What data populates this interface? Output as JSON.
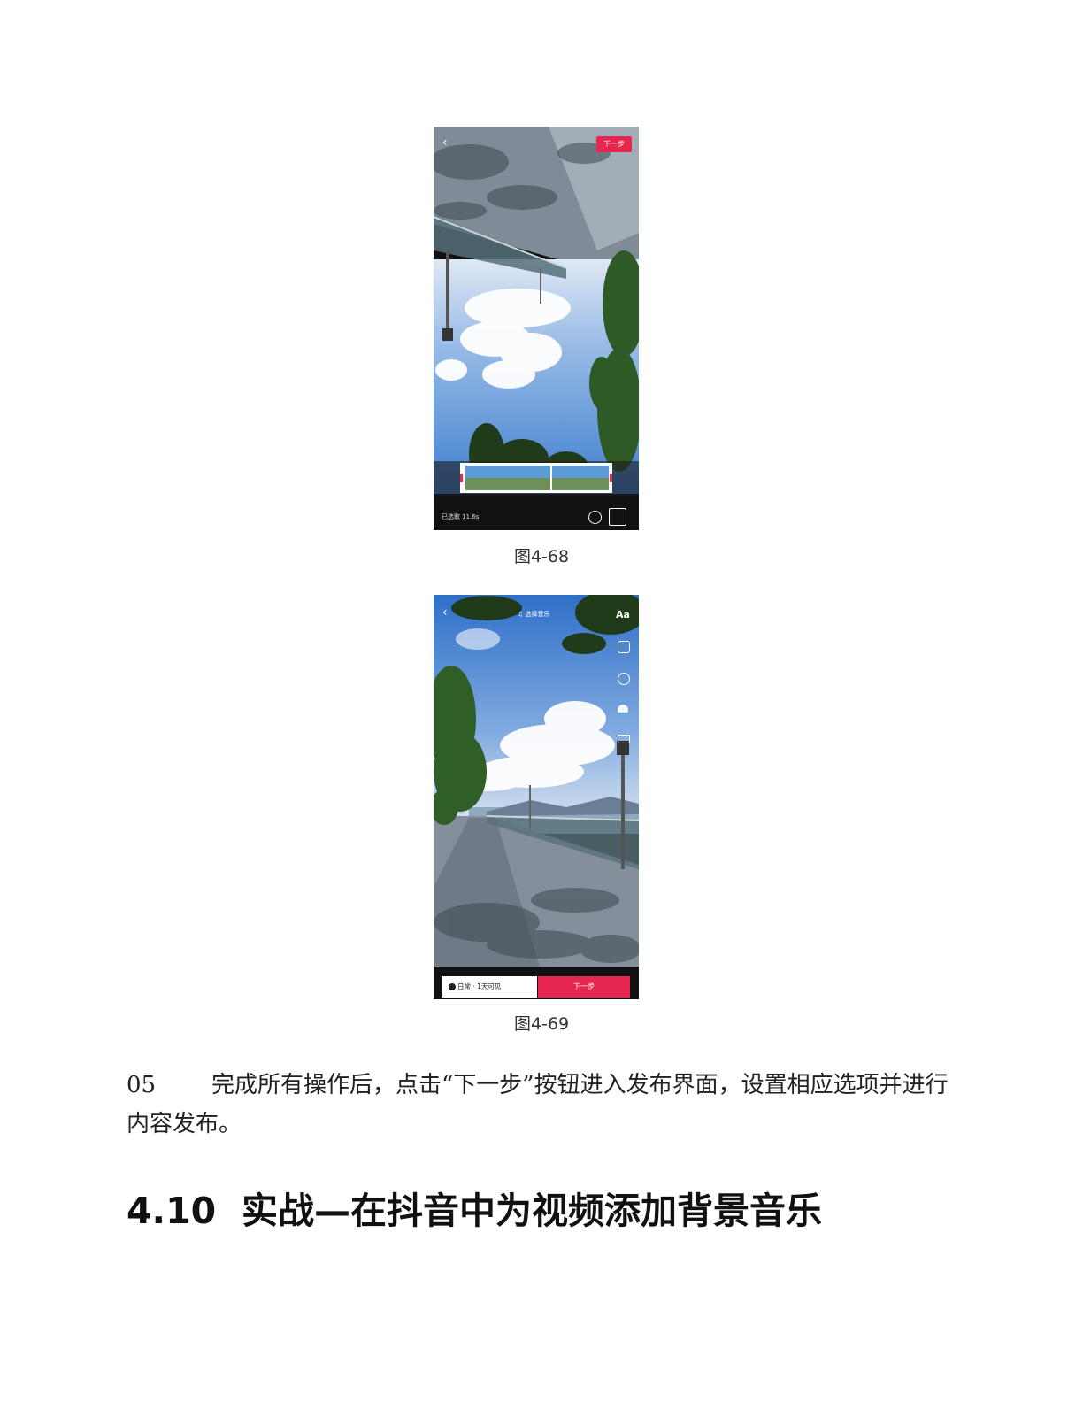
{
  "figure1": {
    "caption": "图4-68",
    "next_button": "下一步",
    "selected_duration": "已选取 11.6s"
  },
  "figure2": {
    "caption": "图4-69",
    "music_button": "选择音乐",
    "text_tool": "Aa",
    "visibility_option": "日常 · 1天可见",
    "next_button": "下一步"
  },
  "step": {
    "number": "05",
    "text": "完成所有操作后，点击“下一步”按钮进入发布界面，设置相应选项并进行内容发布。"
  },
  "section": {
    "number": "4.10",
    "title": "实战—在抖音中为视频添加背景音乐"
  },
  "colors": {
    "accent_red": "#e6264f",
    "sky_blue": "#4a86d4",
    "pavement": "#7d8a96"
  }
}
